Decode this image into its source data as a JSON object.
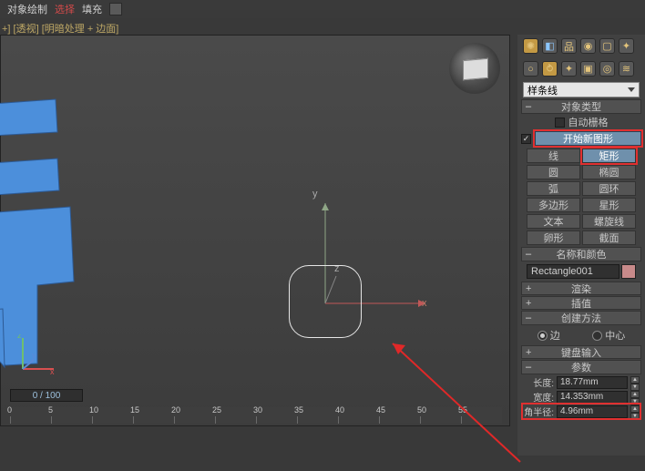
{
  "toolbar": {
    "label1": "对象绘制",
    "mode": "选择",
    "label2": "填充",
    "swatch": "#5a5a5a"
  },
  "view": {
    "label": "+] [透视] [明暗处理 + 边面]"
  },
  "sidebar": {
    "dropdown": "样条线",
    "sec_obj_type": "对象类型",
    "autogrid": "自动栅格",
    "start_new_shape": "开始新图形",
    "shapes": {
      "line": "线",
      "rectangle": "矩形",
      "circle": "圆",
      "ellipse": "椭圆",
      "arc": "弧",
      "donut": "圆环",
      "ngon": "多边形",
      "star": "星形",
      "text": "文本",
      "helix": "螺旋线",
      "egg": "卵形",
      "section": "截面"
    },
    "sec_name_color": "名称和颜色",
    "obj_name": "Rectangle001",
    "sec_render": "渲染",
    "sec_interp": "插值",
    "sec_method": "创建方法",
    "radio_edge": "边",
    "radio_center": "中心",
    "sec_keyboard": "键盘输入",
    "sec_params": "参数",
    "param_length": "长度:",
    "param_length_val": "18.77mm",
    "param_width": "宽度:",
    "param_width_val": "14.353mm",
    "param_corner": "角半径:",
    "param_corner_val": "4.96mm"
  },
  "timeline": {
    "current": "0 / 100",
    "ticks": [
      "0",
      "5",
      "10",
      "15",
      "20",
      "25",
      "30",
      "35",
      "40",
      "45",
      "50",
      "55"
    ]
  }
}
